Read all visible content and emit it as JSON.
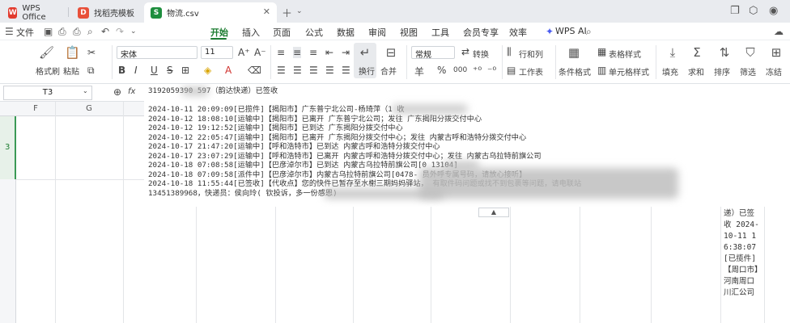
{
  "tabs": [
    {
      "label": "WPS Office",
      "icon": "wps-logo-icon"
    },
    {
      "label": "找稻壳模板",
      "icon": "docer-icon"
    },
    {
      "label": "物流.csv",
      "icon": "spreadsheet-icon",
      "icon_letter": "S"
    }
  ],
  "menu": {
    "file": "文件",
    "items": [
      "开始",
      "插入",
      "页面",
      "公式",
      "数据",
      "审阅",
      "视图",
      "工具",
      "会员专享",
      "效率"
    ],
    "active": "开始",
    "wps_ai": "WPS AI"
  },
  "ribbon": {
    "format_painter": "格式刷",
    "paste": "粘贴",
    "font_name": "宋体",
    "font_size": "11",
    "bold": "B",
    "italic": "I",
    "underline": "U",
    "font_color_letter": "A",
    "wrap": "换行",
    "merge": "合并",
    "number_format": "常规",
    "convert": "转换",
    "rows_cols": "行和列",
    "worksheet": "工作表",
    "cond_format": "条件格式",
    "table_style": "表格样式",
    "cell_style": "单元格样式",
    "fill": "填充",
    "sum": "求和",
    "sort": "排序",
    "filter": "筛选",
    "freeze": "冻结",
    "currency": "羊",
    "percent": "%",
    "thousands": "000"
  },
  "formula_bar": {
    "cell_ref": "T3",
    "fx": "fx"
  },
  "grid": {
    "columns": [
      "F",
      "G"
    ],
    "rows": [
      "3"
    ]
  },
  "popup": {
    "lines": [
      "3192059390    597（韵达快递）已签收",
      "",
      "2024-10-11 20:09:09[已揽件]【揭阳市】广东普宁北公司-杨琦萍（1               收",
      "2024-10-12 18:08:10[运输中]【揭阳市】已离开 广东普宁北公司；发往 广东揭阳分拨交付中心",
      "2024-10-12 19:12:52[运输中]【揭阳市】已到达 广东揭阳分拨交付中心",
      "2024-10-12 22:05:47[运输中]【揭阳市】已离开 广东揭阳分拨交付中心；发往 内蒙古呼和浩特分拨交付中心",
      "2024-10-17 21:47:20[运输中]【呼和浩特市】已到达 内蒙古呼和浩特分拨交付中心",
      "2024-10-17 23:07:29[运输中]【呼和浩特市】已离开 内蒙古呼和浩特分拨交付中心；发往 内蒙古乌拉特前旗公司",
      "2024-10-18 07:08:58[运输中]【巴彦淖尔市】已到达 内蒙古乌拉特前旗公司[0      13104]",
      "2024-10-18 07:09:58[派件中]【巴彦淖尔市】内蒙古乌拉特前旗公司[0478-                             员外呼专属号码，请放心接听】",
      "2024-10-18 11:55:44[已签收]【代收点】您的快件已暂存至水榭三期妈妈驿站，               有取件码问题或找不到包裹等问题，请电联站",
      "13451389968，快递员：侯向玲(                                    钦投诉，多一份感恩)"
    ]
  },
  "cell_text": "递）已签收 2024-10-11 16:38:07[已揽件]【周口市】河南周口川汇公司"
}
